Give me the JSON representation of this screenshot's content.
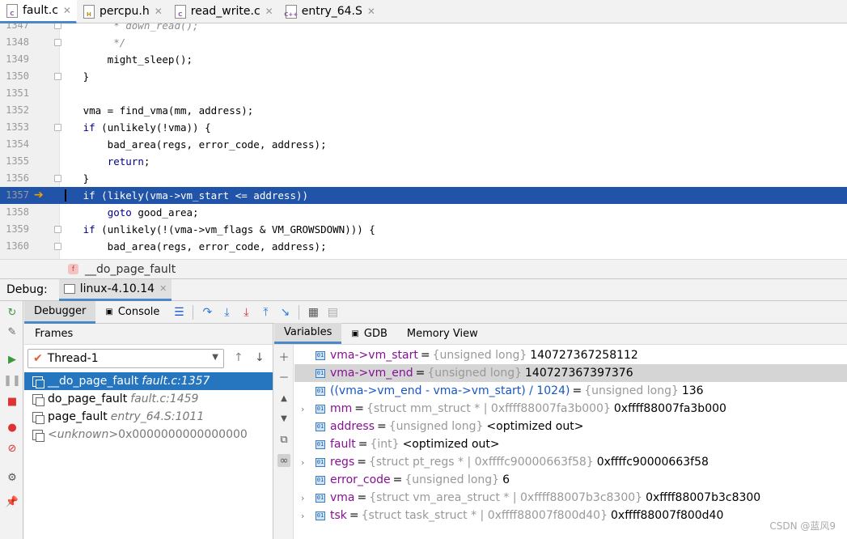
{
  "tabs": [
    {
      "label": "fault.c",
      "icon": "c-file-icon",
      "active": true
    },
    {
      "label": "percpu.h",
      "icon": "h-file-icon",
      "active": false
    },
    {
      "label": "read_write.c",
      "icon": "c-file-icon",
      "active": false
    },
    {
      "label": "entry_64.S",
      "icon": "cpp-file-icon",
      "active": false
    }
  ],
  "icon_letters": {
    "c": "C",
    "h": "H",
    "cpp": "C++"
  },
  "close_glyph": "✕",
  "editor": {
    "lines": [
      {
        "num": "1347",
        "text": "        * down_read();"
      },
      {
        "num": "1348",
        "text": "        */"
      },
      {
        "num": "1349",
        "text": "       might_sleep();"
      },
      {
        "num": "1350",
        "text": "   }"
      },
      {
        "num": "1351",
        "text": ""
      },
      {
        "num": "1352",
        "text": "   vma = find_vma(mm, address);"
      },
      {
        "num": "1353",
        "text": "   if (unlikely(!vma)) {"
      },
      {
        "num": "1354",
        "text": "       bad_area(regs, error_code, address);"
      },
      {
        "num": "1355",
        "text": "       return;"
      },
      {
        "num": "1356",
        "text": "   }"
      },
      {
        "num": "1357",
        "text": "   if (likely(vma->vm_start <= address))"
      },
      {
        "num": "1358",
        "text": "       goto good_area;"
      },
      {
        "num": "1359",
        "text": "   if (unlikely(!(vma->vm_flags & VM_GROWSDOWN))) {"
      },
      {
        "num": "1360",
        "text": "       bad_area(regs, error_code, address);"
      }
    ],
    "current_line": "1357",
    "exec_arrow": "➔"
  },
  "breadcrumb": {
    "badge": "f",
    "function": "__do_page_fault"
  },
  "debug": {
    "label": "Debug:",
    "session": "linux-4.10.14",
    "close": "✕"
  },
  "toolbar": {
    "debugger_tab": "Debugger",
    "console_tab": "Console",
    "buttons": [
      "menu-icon",
      "step-over-icon",
      "step-into-icon",
      "force-step-into-icon",
      "step-out-icon",
      "run-to-cursor-icon",
      "evaluate-icon",
      "table-icon"
    ]
  },
  "frames": {
    "header": "Frames",
    "thread": "Thread-1",
    "items": [
      {
        "func": "__do_page_fault",
        "loc": "fault.c:1357",
        "selected": true
      },
      {
        "func": "do_page_fault",
        "loc": "fault.c:1459",
        "selected": false
      },
      {
        "func": "page_fault",
        "loc": "entry_64.S:1011",
        "selected": false
      },
      {
        "func": "<unknown>",
        "loc": "0x0000000000000000",
        "selected": false
      }
    ]
  },
  "variables": {
    "tabs": [
      "Variables",
      "GDB",
      "Memory View"
    ],
    "rows": [
      {
        "expand": "",
        "name": "vma->vm_start",
        "type": "{unsigned long}",
        "value": "140727367258112",
        "name_color": "purple",
        "selected": false
      },
      {
        "expand": "",
        "name": "vma->vm_end",
        "type": "{unsigned long}",
        "value": "140727367397376",
        "name_color": "purple",
        "selected": true
      },
      {
        "expand": "",
        "name": "((vma->vm_end - vma->vm_start) / 1024)",
        "type": "{unsigned long}",
        "value": "136",
        "name_color": "blue",
        "selected": false
      },
      {
        "expand": "›",
        "name": "mm",
        "type": "{struct mm_struct * | 0xffff88007fa3b000}",
        "value": "0xffff88007fa3b000",
        "name_color": "purple",
        "selected": false
      },
      {
        "expand": "",
        "name": "address",
        "type": "{unsigned long}",
        "value": "<optimized out>",
        "name_color": "purple",
        "selected": false
      },
      {
        "expand": "",
        "name": "fault",
        "type": "{int}",
        "value": "<optimized out>",
        "name_color": "purple",
        "selected": false
      },
      {
        "expand": "›",
        "name": "regs",
        "type": "{struct pt_regs * | 0xffffc90000663f58}",
        "value": "0xffffc90000663f58",
        "name_color": "purple",
        "selected": false
      },
      {
        "expand": "",
        "name": "error_code",
        "type": "{unsigned long}",
        "value": "6",
        "name_color": "purple",
        "selected": false
      },
      {
        "expand": "›",
        "name": "vma",
        "type": "{struct vm_area_struct * | 0xffff88007b3c8300}",
        "value": "0xffff88007b3c8300",
        "name_color": "purple",
        "selected": false
      },
      {
        "expand": "›",
        "name": "tsk",
        "type": "{struct task_struct * | 0xffff88007f800d40}",
        "value": "0xffff88007f800d40",
        "name_color": "purple",
        "selected": false
      }
    ],
    "var_badge": "01",
    "eq": "="
  },
  "watermark": "CSDN @蓝风9",
  "colors": {
    "accent": "#4a88c7",
    "highlight": "#2154a8",
    "selection": "#2675bf",
    "keyword": "#00008b",
    "var_name": "#871094"
  }
}
